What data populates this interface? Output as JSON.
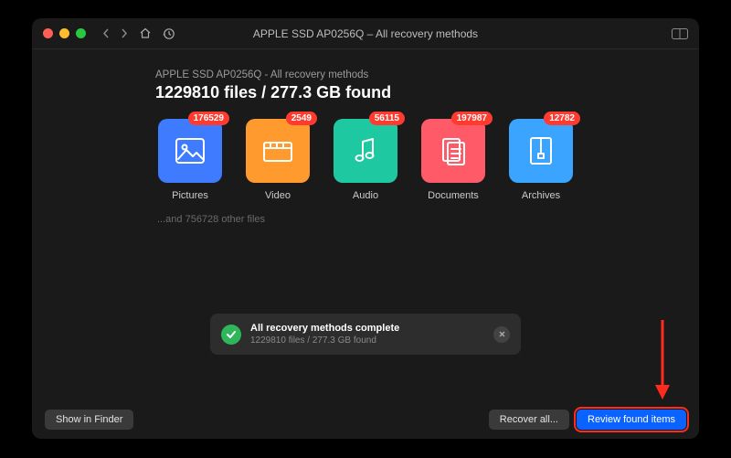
{
  "window_title": "APPLE SSD AP0256Q – All recovery methods",
  "subtitle": "APPLE SSD AP0256Q - All recovery methods",
  "headline": "1229810 files / 277.3 GB found",
  "categories": [
    {
      "name": "pictures",
      "label": "Pictures",
      "count": "176529",
      "color": "#3e7bff",
      "icon": "image"
    },
    {
      "name": "video",
      "label": "Video",
      "count": "2549",
      "color": "#ff9a2e",
      "icon": "film"
    },
    {
      "name": "audio",
      "label": "Audio",
      "count": "56115",
      "color": "#1ec9a2",
      "icon": "note"
    },
    {
      "name": "documents",
      "label": "Documents",
      "count": "197987",
      "color": "#ff5a68",
      "icon": "doc"
    },
    {
      "name": "archives",
      "label": "Archives",
      "count": "12782",
      "color": "#3aa4ff",
      "icon": "zip"
    }
  ],
  "other_files_text": "...and 756728 other files",
  "status": {
    "title": "All recovery methods complete",
    "subtitle": "1229810 files / 277.3 GB found"
  },
  "buttons": {
    "show_in_finder": "Show in Finder",
    "recover_all": "Recover all...",
    "review": "Review found items"
  }
}
